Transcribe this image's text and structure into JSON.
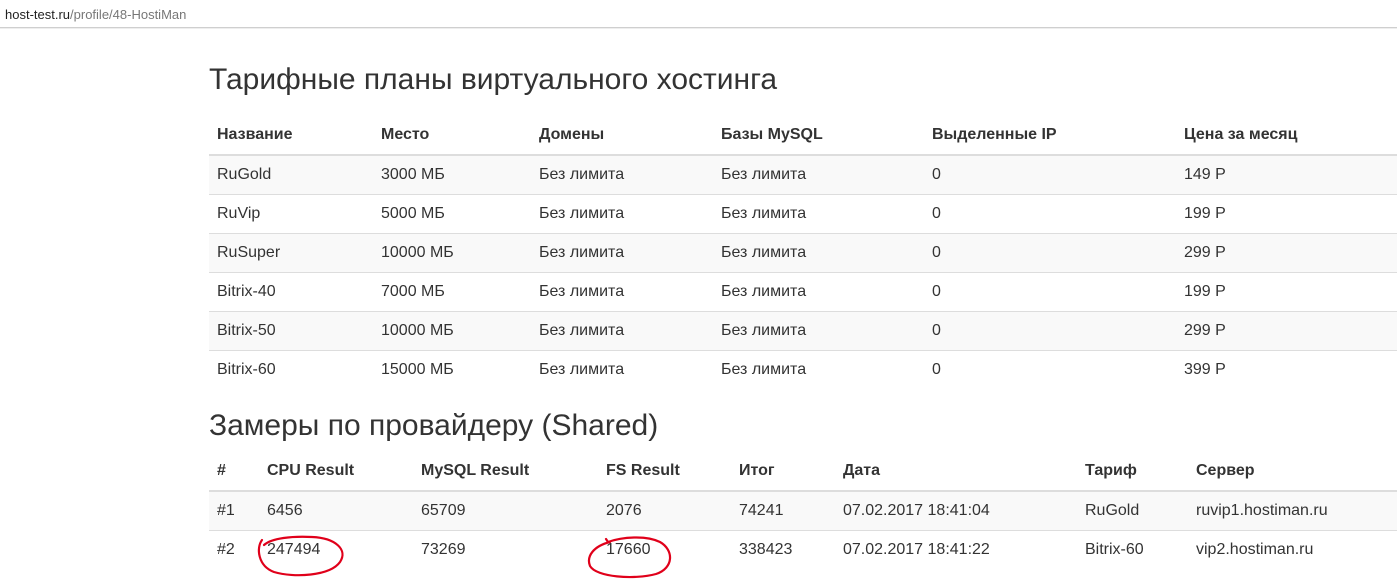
{
  "browser": {
    "url_host": "host-test.ru",
    "url_path": "/profile/48-HostiMan"
  },
  "plans": {
    "title": "Тарифные планы виртуального хостинга",
    "headers": [
      "Название",
      "Место",
      "Домены",
      "Базы MySQL",
      "Выделенные IP",
      "Цена за месяц"
    ],
    "rows": [
      [
        "RuGold",
        "3000 МБ",
        "Без лимита",
        "Без лимита",
        "0",
        "149 Р"
      ],
      [
        "RuVip",
        "5000 МБ",
        "Без лимита",
        "Без лимита",
        "0",
        "199 Р"
      ],
      [
        "RuSuper",
        "10000 МБ",
        "Без лимита",
        "Без лимита",
        "0",
        "299 Р"
      ],
      [
        "Bitrix-40",
        "7000 МБ",
        "Без лимита",
        "Без лимита",
        "0",
        "199 Р"
      ],
      [
        "Bitrix-50",
        "10000 МБ",
        "Без лимита",
        "Без лимита",
        "0",
        "299 Р"
      ],
      [
        "Bitrix-60",
        "15000 МБ",
        "Без лимита",
        "Без лимита",
        "0",
        "399 Р"
      ]
    ]
  },
  "bench": {
    "title": "Замеры по провайдеру (Shared)",
    "headers": [
      "#",
      "CPU Result",
      "MySQL Result",
      "FS Result",
      "Итог",
      "Дата",
      "Тариф",
      "Сервер"
    ],
    "rows": [
      [
        "#1",
        "6456",
        "65709",
        "2076",
        "74241",
        "07.02.2017 18:41:04",
        "RuGold",
        "ruvip1.hostiman.ru"
      ],
      [
        "#2",
        "247494",
        "73269",
        "17660",
        "338423",
        "07.02.2017 18:41:22",
        "Bitrix-60",
        "vip2.hostiman.ru"
      ]
    ]
  },
  "annotation_color": "#e0001a"
}
